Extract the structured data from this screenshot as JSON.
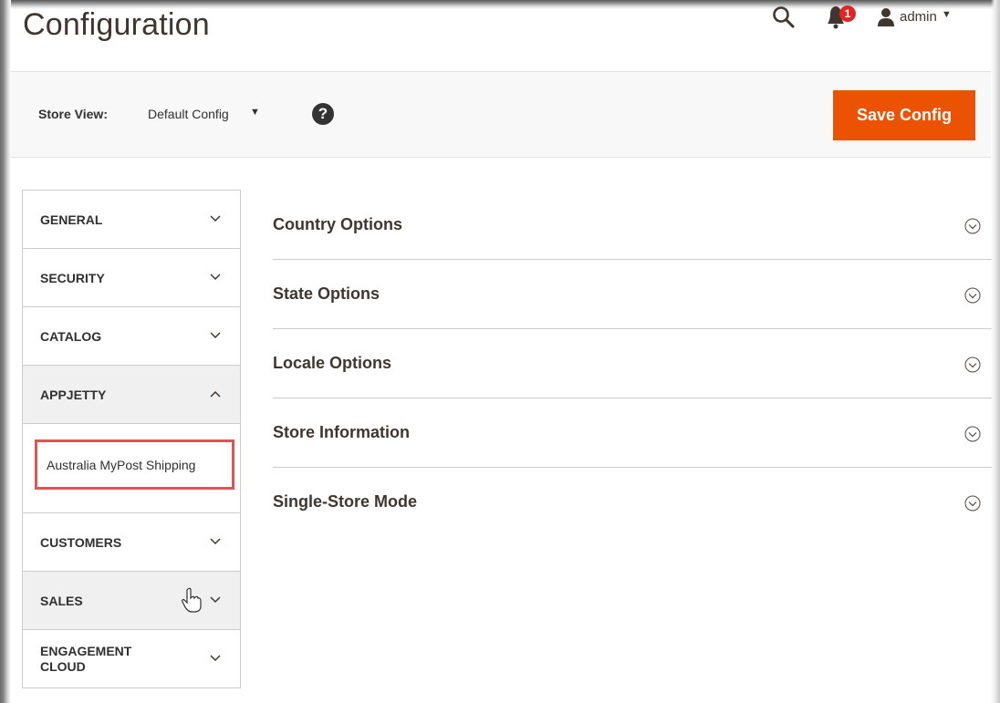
{
  "header": {
    "title": "Configuration",
    "notifications_count": "1",
    "user_name": "admin"
  },
  "store_bar": {
    "label": "Store View:",
    "current_scope": "Default Config",
    "help_symbol": "?",
    "save_label": "Save Config",
    "accent_color": "#eb5202"
  },
  "sidebar": {
    "tabs": [
      {
        "label": "GENERAL",
        "expanded": false
      },
      {
        "label": "SECURITY",
        "expanded": false
      },
      {
        "label": "CATALOG",
        "expanded": false
      },
      {
        "label": "APPJETTY",
        "expanded": true,
        "items": [
          "Australia MyPost Shipping"
        ]
      },
      {
        "label": "CUSTOMERS",
        "expanded": false
      },
      {
        "label": "SALES",
        "expanded": false
      },
      {
        "label": "ENGAGEMENT CLOUD",
        "expanded": false
      }
    ],
    "highlight_color": "#e05254"
  },
  "sections": [
    {
      "title": "Country Options"
    },
    {
      "title": "State Options"
    },
    {
      "title": "Locale Options"
    },
    {
      "title": "Store Information"
    },
    {
      "title": "Single-Store Mode"
    }
  ],
  "icons": [
    "search-icon",
    "bell-icon",
    "user-icon",
    "chevron-down-icon",
    "chevron-up-icon",
    "circle-chevron-icon",
    "hand-pointer-icon"
  ]
}
